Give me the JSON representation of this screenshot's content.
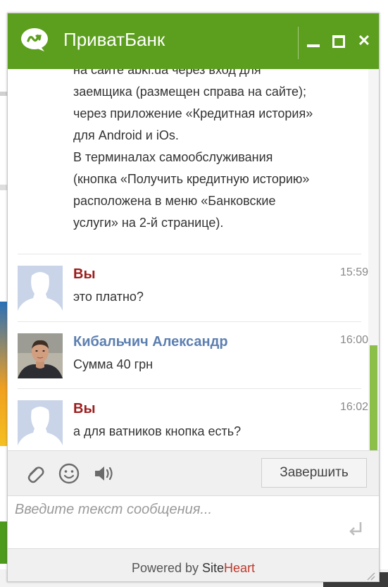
{
  "window": {
    "title": "ПриватБанк",
    "buttons": {
      "minimize": "minimize",
      "maximize": "maximize",
      "close": "✕"
    }
  },
  "chat": {
    "intro_lines": [
      "на сайте abki.ua через вход для",
      "заемщика (размещен справа на сайте);",
      "через приложение «Кредитная история»",
      "для Android и iOs.",
      "В терминалах самообслуживания",
      "(кнопка «Получить кредитную историю»",
      "расположена в меню «Банковские",
      "услуги» на 2-й странице)."
    ],
    "messages": [
      {
        "sender": "Вы",
        "time": "15:59",
        "text": "это платно?"
      },
      {
        "sender": "Кибальчич Александр",
        "time": "16:00",
        "text": "Сумма 40 грн"
      },
      {
        "sender": "Вы",
        "time": "16:02",
        "text": "а для ватников кнопка есть?"
      }
    ]
  },
  "toolbar": {
    "icons": [
      "paperclip-icon",
      "smiley-icon",
      "speaker-icon"
    ],
    "finish_label": "Завершить"
  },
  "input": {
    "placeholder": "Введите текст сообщения...",
    "value": ""
  },
  "footer": {
    "powered_label": "Powered by",
    "brand_site": "Site",
    "brand_heart": "Heart"
  },
  "colors": {
    "header": "#5c9e1d",
    "user_name": "#9b1d1d",
    "operator_name": "#5c7fb0",
    "scroll_thumb": "#8bbf4a"
  }
}
